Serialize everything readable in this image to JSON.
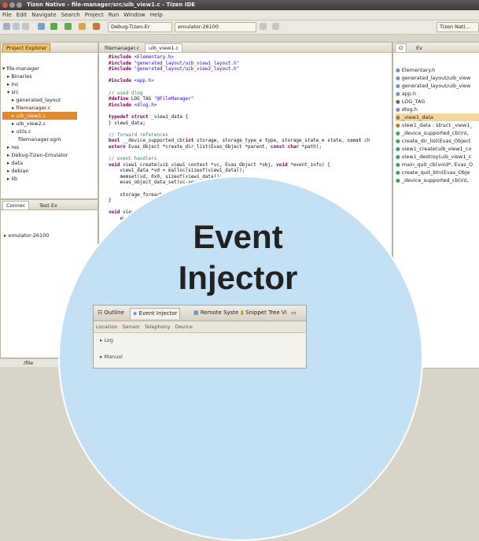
{
  "window": {
    "title": "Tizen Native - file-manager/src/uib_view1.c - Tizen IDE"
  },
  "menu": [
    "File",
    "Edit",
    "Navigate",
    "Search",
    "Project",
    "Run",
    "Window",
    "Help"
  ],
  "toolbar": {
    "build_config": "Debug-Tizen-Er",
    "target": "emulator-26100",
    "perspective": "Tizen Nati..."
  },
  "project_explorer": {
    "tab": "Project Explorer",
    "items": [
      "file-manager",
      "Binaries",
      "inc",
      "src",
      "generated_layout",
      "filemanager.c",
      "uib_view1.c",
      "uib_view2.c",
      "utils.c",
      "filemanager.sgm",
      "res",
      "Debug-Tizen-Emulator",
      "data",
      "debian",
      "lib"
    ]
  },
  "connection": {
    "tabs": [
      "Connec",
      "Test Ex"
    ],
    "device": "emulator-26100"
  },
  "editor": {
    "tabs": [
      "filemanager.c",
      "uib_view1.c"
    ],
    "lines": [
      "#include <Elementary.h>",
      "#include \"generated_layout/uib_view1_layout.h\"",
      "#include \"generated_layout/uib_view2_layout.h\"",
      "",
      "#include <app.h>",
      "",
      "// used dlog",
      "#define LOG_TAG \"@FileManager\"",
      "#include <dlog.h>",
      "",
      "typedef struct _view1_data {",
      "} view1_data;",
      "",
      "// forward references",
      "bool __device_supported_cb(int storage, storage_type_e type, storage_state_e state, const ch",
      "extern Evas_Object *create_dir_list(Evas_Object *parent, const char *path);",
      "",
      "// event handlers",
      "void view1_create(uib_view1_context *vc, Evas_Object *obj, void *event_info) {",
      "    view1_data *vd = malloc(sizeof(view1_data));",
      "    memset(vd, 0x0, sizeof(view1_data));",
      "    evas_object_data_set(vc->evas_object, \"vd\", vd);",
      "",
      "    storage_foreach_device_supported( device_supported_cb, vc);",
      "}",
      "",
      "void view1_d                                   nt_info) {",
      "    evas"
    ]
  },
  "outline": {
    "tabs": [
      "O",
      "Ev"
    ],
    "items": [
      "Elementary.h",
      "generated_layout/uib_view",
      "generated_layout/uib_view",
      "app.h",
      "LOG_TAG",
      "dlog.h",
      "_view1_data",
      "view1_data : struct _view1_",
      "_device_supported_cb(int,",
      "create_dir_list(Evas_Object",
      "view1_create(uib_view1_co",
      "view1_destroy(uib_view1_c",
      "main_quit_cb(void*, Evas_O",
      "create_quit_btn(Evas_Obje",
      "_device_supported_cb(int,"
    ]
  },
  "overlay": {
    "title_line1": "Event",
    "title_line2": "Injector",
    "panel_tabs": [
      "Outline",
      "Event Injector",
      "Remote Syste",
      "Snippet Tree Vi"
    ],
    "sub_tabs": [
      "Location",
      "Sensor",
      "Telephony",
      "Device"
    ],
    "rows": [
      "Log",
      "Manual"
    ]
  },
  "statusbar": {
    "left": "/file"
  }
}
